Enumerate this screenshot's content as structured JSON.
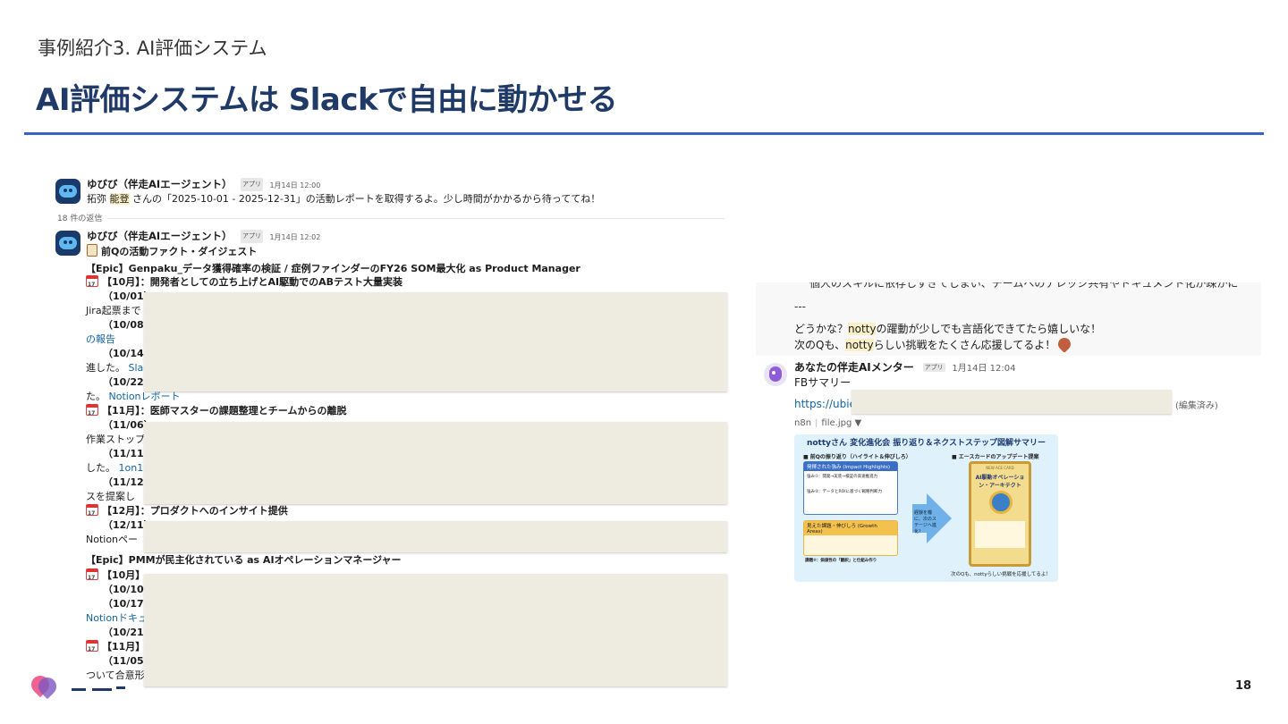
{
  "slide": {
    "kicker": "事例紹介3. AI評価システム",
    "title": "AI評価システムは Slackで自由に動かせる",
    "page_number": "18",
    "accent_color": "#3b62c9"
  },
  "thread": {
    "message1": {
      "sender": "ゆびび（伴走AIエージェント）",
      "app_tag": "アプリ",
      "timestamp": "1月14日 12:00",
      "text_prefix": "拓弥 ",
      "text_highlight": "能登",
      "text_suffix": " さんの「2025-10-01 - 2025-12-31」の活動レポートを取得するよ。少し時間がかかるから待っててね！"
    },
    "replies": "18 件の返信",
    "message2": {
      "sender": "ゆびび（伴走AIエージェント）",
      "app_tag": "アプリ",
      "timestamp": "1月14日 12:02",
      "heading": "前Qの活動ファクト・ダイジェスト"
    },
    "lines": {
      "epic1": "【Epic】Genpaku_データ獲得確率の検証 / 症例ファインダーのFY26 SOM最大化 as Product Manager",
      "oct1": "【10月】：開発者としての立ち上げとAI駆動でのABテスト大量実装",
      "d1001": "（10/01）",
      "jira": "Jira起票まで",
      "d1008": "（10/08）",
      "report": "の報告",
      "d1014": "（10/14）",
      "progress": "進した。",
      "slack_link": "Slac",
      "d1022": "（10/22）",
      "ta": "た。",
      "notion_report": "Notionレポート",
      "nov1": "【11月】：医師マスターの課題整理とチームからの離脱",
      "d1106": "（11/06）",
      "stop": "作業ストップ",
      "d1111": "（11/11）",
      "shita": "した。",
      "one_on_one": "1on1",
      "d1112": "（11/12）",
      "proposal": "スを提案し",
      "dec1": "【12月】：プロダクトへのインサイト提供",
      "d1211": "（12/11）",
      "notion_page": "Notionペー",
      "epic2": "【Epic】PMMが民主化されている as AIオペレーションマネージャー",
      "oct2": "【10月】",
      "d1010": "（10/10）",
      "d1017": "（10/17）",
      "notion_doc": "Notionドキュ",
      "d1021": "（10/21）",
      "nov2": "【11月】",
      "d1105": "（11/05）",
      "agreement": "ついて合意形"
    }
  },
  "right_panel": {
    "cut_line": "個人のスキルに依存しすぎてしまい、チームへのナレッジ共有やドキュメント化が疎かに",
    "dashes": "---",
    "line1_prefix": "どうかな？",
    "line1_highlight": "notty",
    "line1_suffix": "の躍動が少しでも言語化できてたら嬉しいな！",
    "line2_prefix": "次のQも、",
    "line2_highlight": "notty",
    "line2_suffix": "らしい挑戦をたくさん応援してるよ！",
    "mentor": {
      "sender": "あなたの伴走AIメンター",
      "app_tag": "アプリ",
      "timestamp": "1月14日 12:04",
      "summary": "FBサマリー",
      "url": "https://ubie.",
      "edited": "(編集済み)",
      "source": "n8n",
      "file": "file.jpg"
    },
    "infographic": {
      "title": "nottyさん 変化進化会 振り返り＆ネクストステップ図解サマリー",
      "section_left": "■ 前Qの振り返り（ハイライト＆伸びしろ）",
      "section_right": "■ エースカードのアップデート提案",
      "impact": "発揮された強み (Impact Highlights)",
      "strength1": "強み①：開発→実装→検証の高速推進力",
      "strength2": "強み②：データとROIに基づく戦略判断力",
      "growth": "見えた課題・伸びしろ (Growth Areas)",
      "task2": "課題②：価値性の「翻訳」と仕組み作り",
      "arrow_text": "経験を糧に、次のステージへ進化！",
      "card_tag": "NEW ACE CARD",
      "card_title": "AI駆動オペレーション・アーキテクト",
      "footer": "次のQも、nottyらしい挑戦を応援してるよ！"
    }
  }
}
